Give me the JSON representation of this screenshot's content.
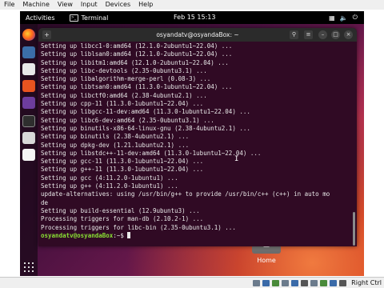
{
  "host_menu": [
    "File",
    "Machine",
    "View",
    "Input",
    "Devices",
    "Help"
  ],
  "host_status": {
    "right_ctrl": "Right Ctrl"
  },
  "topbar": {
    "activities": "Activities",
    "app_name": "Terminal",
    "clock": "Feb 15  15:13",
    "tray_icons": [
      "network-icon",
      "volume-icon",
      "power-icon"
    ]
  },
  "dock": {
    "apps": [
      "firefox-icon",
      "files-icon",
      "libreoffice-icon",
      "software-center-icon",
      "help-icon",
      "terminal-icon",
      "disk-icon",
      "trash-icon"
    ],
    "show_apps_icon": "app-grid-icon"
  },
  "desktop": {
    "home_label": "Home"
  },
  "terminal": {
    "title": "osyandatv@osyandaBox: ~",
    "lines": [
      "Setting up libcc1-0:amd64 (12.1.0-2ubuntu1~22.04) ...",
      "Setting up liblsan0:amd64 (12.1.0-2ubuntu1~22.04) ...",
      "Setting up libitm1:amd64 (12.1.0-2ubuntu1~22.04) ...",
      "Setting up libc-devtools (2.35-0ubuntu3.1) ...",
      "Setting up libalgorithm-merge-perl (0.08-3) ...",
      "Setting up libtsan0:amd64 (11.3.0-1ubuntu1~22.04) ...",
      "Setting up libctf0:amd64 (2.38-4ubuntu2.1) ...",
      "Setting up cpp-11 (11.3.0-1ubuntu1~22.04) ...",
      "Setting up libgcc-11-dev:amd64 (11.3.0-1ubuntu1~22.04) ...",
      "Setting up libc6-dev:amd64 (2.35-0ubuntu3.1) ...",
      "Setting up binutils-x86-64-linux-gnu (2.38-4ubuntu2.1) ...",
      "Setting up binutils (2.38-4ubuntu2.1) ...",
      "Setting up dpkg-dev (1.21.1ubuntu2.1) ...",
      "Setting up libstdc++-11-dev:amd64 (11.3.0-1ubuntu1~22.04) ...",
      "Setting up gcc-11 (11.3.0-1ubuntu1~22.04) ...",
      "Setting up g++-11 (11.3.0-1ubuntu1~22.04) ...",
      "Setting up gcc (4:11.2.0-1ubuntu1) ...",
      "Setting up g++ (4:11.2.0-1ubuntu1) ...",
      "update-alternatives: using /usr/bin/g++ to provide /usr/bin/c++ (c++) in auto mo",
      "de",
      "Setting up build-essential (12.9ubuntu3) ...",
      "Processing triggers for man-db (2.10.2-1) ...",
      "Processing triggers for libc-bin (2.35-0ubuntu3.1) ..."
    ],
    "prompt_user": "osyandatv@osyandaBox",
    "prompt_suffix": ":~$ "
  }
}
